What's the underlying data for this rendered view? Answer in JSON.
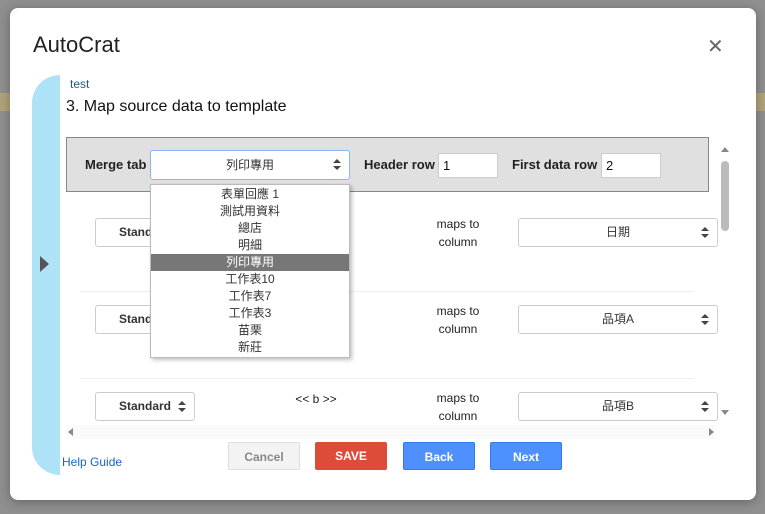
{
  "dialog": {
    "title": "AutoCrat",
    "close_icon": "close-icon"
  },
  "project_name": "test",
  "step_heading": "3. Map source data to template",
  "header": {
    "merge_tab_label": "Merge tab",
    "merge_tab_value": "列印專用",
    "header_row_label": "Header row",
    "header_row_value": "1",
    "first_data_row_label": "First data row",
    "first_data_row_value": "2"
  },
  "dropdown": {
    "options": [
      "表單回應 1",
      "測試用資料",
      "總店",
      "明細",
      "列印專用",
      "工作表10",
      "工作表7",
      "工作表3",
      "苗栗",
      "新莊"
    ],
    "selected": "列印專用"
  },
  "rows": [
    {
      "type": "Standard",
      "tag": "",
      "maps_to": "maps to column",
      "column": "日期"
    },
    {
      "type": "Standard",
      "tag": "",
      "maps_to": "maps to column",
      "column": "品項A"
    },
    {
      "type": "Standard",
      "tag": "<< b >>",
      "maps_to": "maps to column",
      "column": "品項B"
    }
  ],
  "buttons": {
    "cancel": "Cancel",
    "save": "SAVE",
    "back": "Back",
    "next": "Next"
  },
  "help_link": "Help Guide",
  "colors": {
    "save": "#dd4b39",
    "primary": "#4d90fe",
    "sidebar": "#aee3f7",
    "highlight": "#777777"
  }
}
